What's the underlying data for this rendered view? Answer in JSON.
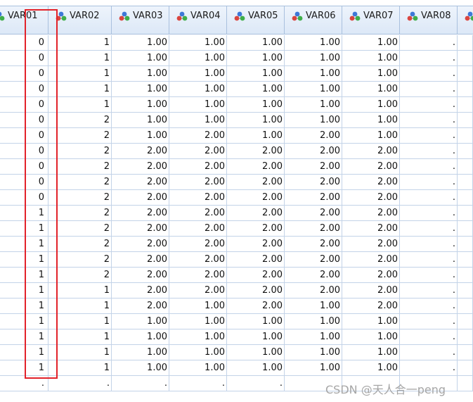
{
  "columns": [
    "VAR01",
    "VAR02",
    "VAR03",
    "VAR04",
    "VAR05",
    "VAR06",
    "VAR07",
    "VAR08"
  ],
  "rows": [
    [
      "0",
      "1",
      "1.00",
      "1.00",
      "1.00",
      "1.00",
      "1.00",
      "."
    ],
    [
      "0",
      "1",
      "1.00",
      "1.00",
      "1.00",
      "1.00",
      "1.00",
      "."
    ],
    [
      "0",
      "1",
      "1.00",
      "1.00",
      "1.00",
      "1.00",
      "1.00",
      "."
    ],
    [
      "0",
      "1",
      "1.00",
      "1.00",
      "1.00",
      "1.00",
      "1.00",
      "."
    ],
    [
      "0",
      "1",
      "1.00",
      "1.00",
      "1.00",
      "1.00",
      "1.00",
      "."
    ],
    [
      "0",
      "2",
      "1.00",
      "1.00",
      "1.00",
      "1.00",
      "1.00",
      "."
    ],
    [
      "0",
      "2",
      "1.00",
      "2.00",
      "1.00",
      "2.00",
      "1.00",
      "."
    ],
    [
      "0",
      "2",
      "2.00",
      "2.00",
      "2.00",
      "2.00",
      "2.00",
      "."
    ],
    [
      "0",
      "2",
      "2.00",
      "2.00",
      "2.00",
      "2.00",
      "2.00",
      "."
    ],
    [
      "0",
      "2",
      "2.00",
      "2.00",
      "2.00",
      "2.00",
      "2.00",
      "."
    ],
    [
      "0",
      "2",
      "2.00",
      "2.00",
      "2.00",
      "2.00",
      "2.00",
      "."
    ],
    [
      "1",
      "2",
      "2.00",
      "2.00",
      "2.00",
      "2.00",
      "2.00",
      "."
    ],
    [
      "1",
      "2",
      "2.00",
      "2.00",
      "2.00",
      "2.00",
      "2.00",
      "."
    ],
    [
      "1",
      "2",
      "2.00",
      "2.00",
      "2.00",
      "2.00",
      "2.00",
      "."
    ],
    [
      "1",
      "2",
      "2.00",
      "2.00",
      "2.00",
      "2.00",
      "2.00",
      "."
    ],
    [
      "1",
      "2",
      "2.00",
      "2.00",
      "2.00",
      "2.00",
      "2.00",
      "."
    ],
    [
      "1",
      "1",
      "2.00",
      "2.00",
      "2.00",
      "2.00",
      "2.00",
      "."
    ],
    [
      "1",
      "1",
      "2.00",
      "1.00",
      "2.00",
      "1.00",
      "2.00",
      "."
    ],
    [
      "1",
      "1",
      "1.00",
      "1.00",
      "1.00",
      "1.00",
      "1.00",
      "."
    ],
    [
      "1",
      "1",
      "1.00",
      "1.00",
      "1.00",
      "1.00",
      "1.00",
      "."
    ],
    [
      "1",
      "1",
      "1.00",
      "1.00",
      "1.00",
      "1.00",
      "1.00",
      "."
    ],
    [
      "1",
      "1",
      "1.00",
      "1.00",
      "1.00",
      "1.00",
      "1.00",
      "."
    ],
    [
      ".",
      ".",
      ".",
      ".",
      ".",
      "",
      "",
      ""
    ]
  ],
  "watermark": "CSDN @天人合一peng",
  "colors": {
    "header_border": "#a9c0de",
    "grid_line": "#c3d3e8",
    "highlight": "#e2222a",
    "icon_red": "#d9453f",
    "icon_green": "#3fae4a",
    "icon_blue": "#3d78d8"
  },
  "header_icon": "nominal-measure-icon"
}
